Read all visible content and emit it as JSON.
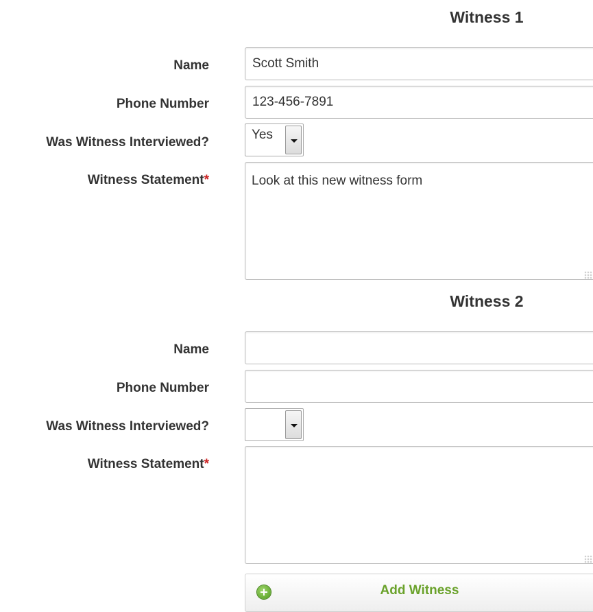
{
  "add_witness_label": "Add Witness",
  "witnesses": [
    {
      "heading": "Witness 1",
      "name_label": "Name",
      "name_value": "Scott Smith",
      "phone_label": "Phone Number",
      "phone_value": "123-456-7891",
      "interviewed_label": "Was Witness Interviewed?",
      "interviewed_value": "Yes",
      "statement_label": "Witness Statement",
      "statement_required_mark": "*",
      "statement_value": "Look at this new witness form"
    },
    {
      "heading": "Witness 2",
      "name_label": "Name",
      "name_value": "",
      "phone_label": "Phone Number",
      "phone_value": "",
      "interviewed_label": "Was Witness Interviewed?",
      "interviewed_value": "",
      "statement_label": "Witness Statement",
      "statement_required_mark": "*",
      "statement_value": ""
    }
  ],
  "colors": {
    "required": "#cc2222",
    "add_button_text": "#6aa22b",
    "add_icon": "#4e9a1c"
  },
  "icons": {
    "add": "plus-circle-icon",
    "dropdown": "chevron-down-icon",
    "resize": "resize-grip-icon"
  }
}
